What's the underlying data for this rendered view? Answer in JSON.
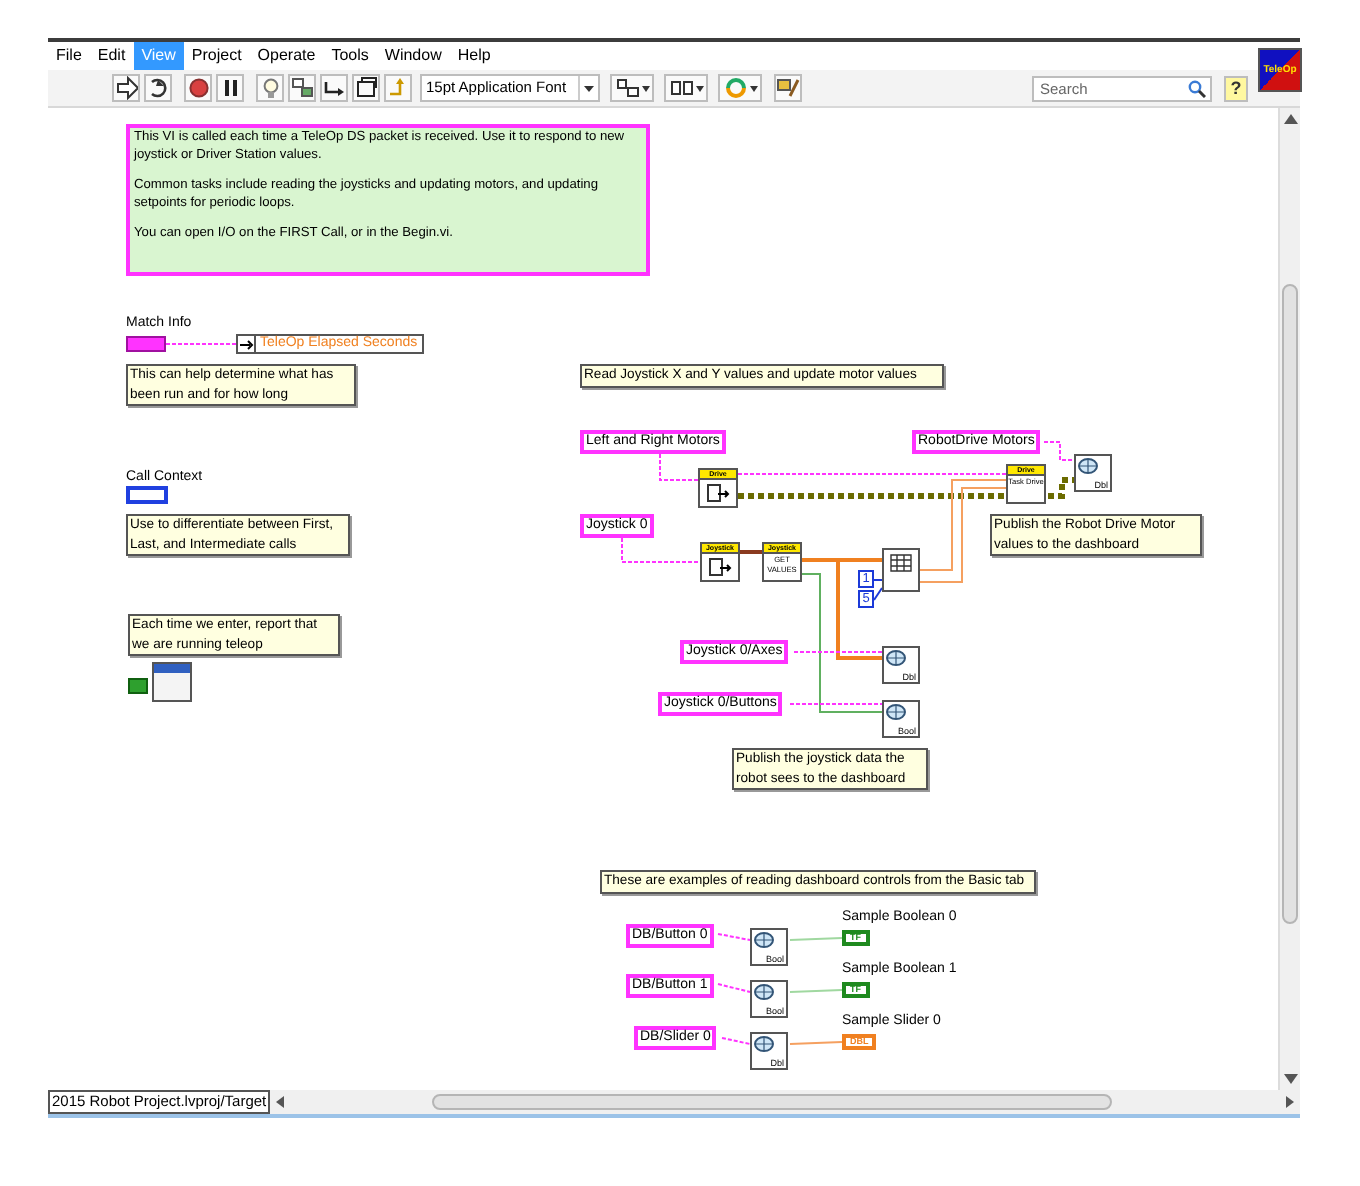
{
  "menu": [
    {
      "label": "File",
      "selected": false
    },
    {
      "label": "Edit",
      "selected": false
    },
    {
      "label": "View",
      "selected": true
    },
    {
      "label": "Project",
      "selected": false
    },
    {
      "label": "Operate",
      "selected": false
    },
    {
      "label": "Tools",
      "selected": false
    },
    {
      "label": "Window",
      "selected": false
    },
    {
      "label": "Help",
      "selected": false
    }
  ],
  "toolbar": {
    "font": "15pt Application Font",
    "search": {
      "placeholder": "Search"
    },
    "help": "?"
  },
  "vi_icon": "TeleOp",
  "diagram": {
    "comments": [
      {
        "kind": "header_note",
        "paragraphs": [
          "This VI is called each time a TeleOp DS packet is received.  Use it to respond to new joystick or Driver Station values.",
          "Common tasks include reading the joysticks and updating motors, and updating setpoints for periodic loops.",
          "You can open I/O on the FIRST Call, or in the Begin.vi."
        ]
      },
      {
        "kind": "note",
        "text": "This can help determine what has been run and for how long"
      },
      {
        "kind": "note",
        "text": "Use to differentiate between First, Last, and Intermediate calls"
      },
      {
        "kind": "note",
        "text": "Each time we enter, report that we are running teleop"
      },
      {
        "kind": "note",
        "text": "Read Joystick X and Y values and update motor values"
      },
      {
        "kind": "note",
        "text": "Publish the Robot Drive Motor values to the dashboard"
      },
      {
        "kind": "note",
        "text": "Publish the joystick data the robot sees to the dashboard"
      },
      {
        "kind": "note",
        "text": "These are examples of reading dashboard controls from the Basic tab"
      }
    ],
    "labels": [
      "Match Info",
      "Call Context",
      "Sample Boolean 0",
      "Sample Boolean 1",
      "Sample Slider 0"
    ],
    "string_constants": [
      "Left and Right Motors",
      "RobotDrive Motors",
      "Joystick 0",
      "Joystick 0/Axes",
      "Joystick 0/Buttons",
      "DB/Button 0",
      "DB/Button 1",
      "DB/Slider 0"
    ],
    "indicators": [
      {
        "kind": "unbundle",
        "text": "TeleOp Elapsed Seconds"
      },
      {
        "kind": "terminal",
        "color": "#1f8a1f",
        "text": "TF"
      },
      {
        "kind": "terminal",
        "color": "#1f8a1f",
        "text": "TF"
      },
      {
        "kind": "terminal",
        "color": "#f08020",
        "text": "DBL"
      }
    ],
    "subvis": [
      {
        "header": "Drive"
      },
      {
        "header": "Drive",
        "body": "Task Drive"
      },
      {
        "header": "Joystick"
      },
      {
        "header": "Joystick",
        "body": "GET VALUES"
      }
    ],
    "dashboard_nodes": [
      {
        "type": "Dbl"
      },
      {
        "type": "Dbl"
      },
      {
        "type": "Bool"
      },
      {
        "type": "Bool"
      },
      {
        "type": "Bool"
      },
      {
        "type": "Dbl"
      }
    ],
    "numeric_constants": [
      "1",
      "5"
    ]
  },
  "status_bar": {
    "path": "2015 Robot Project.lvproj/Target"
  }
}
